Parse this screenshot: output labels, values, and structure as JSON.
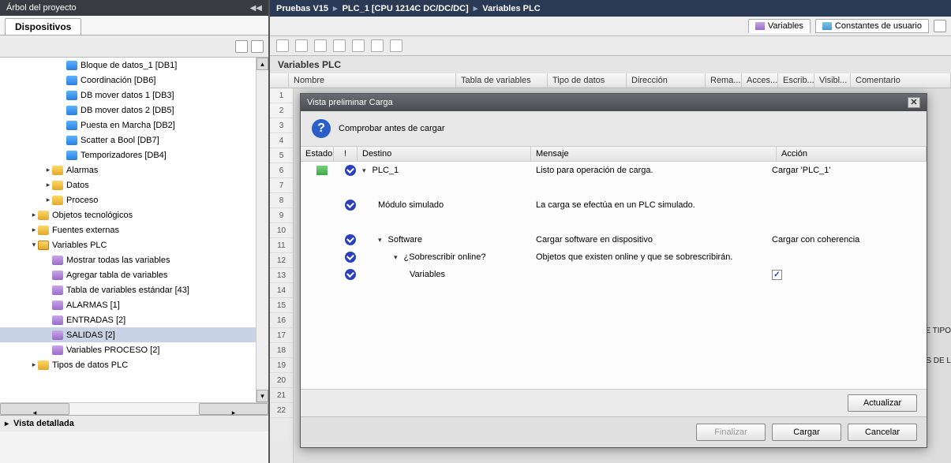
{
  "left": {
    "title": "Árbol del proyecto",
    "tab": "Dispositivos",
    "detailed_view": "Vista detallada",
    "tree": [
      {
        "indent": 3,
        "icon": "db",
        "label": "Bloque de datos_1 [DB1]"
      },
      {
        "indent": 3,
        "icon": "db",
        "label": "Coordinación [DB6]"
      },
      {
        "indent": 3,
        "icon": "db",
        "label": "DB mover datos 1 [DB3]"
      },
      {
        "indent": 3,
        "icon": "db",
        "label": "DB mover datos 2 [DB5]"
      },
      {
        "indent": 3,
        "icon": "db",
        "label": "Puesta en Marcha [DB2]"
      },
      {
        "indent": 3,
        "icon": "db",
        "label": "Scatter a Bool [DB7]"
      },
      {
        "indent": 3,
        "icon": "db",
        "label": "Temporizadores [DB4]"
      },
      {
        "indent": 2,
        "icon": "folder",
        "exp": "▸",
        "label": "Alarmas"
      },
      {
        "indent": 2,
        "icon": "folder",
        "exp": "▸",
        "label": "Datos"
      },
      {
        "indent": 2,
        "icon": "folder",
        "exp": "▸",
        "label": "Proceso"
      },
      {
        "indent": 1,
        "icon": "folder",
        "exp": "▸",
        "label": "Objetos tecnológicos"
      },
      {
        "indent": 1,
        "icon": "folder",
        "exp": "▸",
        "label": "Fuentes externas"
      },
      {
        "indent": 1,
        "icon": "varfolder",
        "exp": "▾",
        "label": "Variables PLC"
      },
      {
        "indent": 2,
        "icon": "vartable",
        "label": "Mostrar todas las variables"
      },
      {
        "indent": 2,
        "icon": "vartable",
        "label": "Agregar tabla de variables"
      },
      {
        "indent": 2,
        "icon": "vartable",
        "label": "Tabla de variables estándar [43]"
      },
      {
        "indent": 2,
        "icon": "vartable",
        "label": "ALARMAS [1]"
      },
      {
        "indent": 2,
        "icon": "vartable",
        "label": "ENTRADAS [2]"
      },
      {
        "indent": 2,
        "icon": "vartable",
        "label": "SALIDAS [2]",
        "selected": true
      },
      {
        "indent": 2,
        "icon": "vartable",
        "label": "Variables PROCESO [2]"
      },
      {
        "indent": 1,
        "icon": "folder",
        "exp": "▸",
        "label": "Tipos de datos PLC"
      }
    ]
  },
  "breadcrumb": {
    "a": "Pruebas V15",
    "b": "PLC_1 [CPU 1214C DC/DC/DC]",
    "c": "Variables PLC"
  },
  "subtabs": {
    "vars": "Variables",
    "consts": "Constantes de usuario"
  },
  "section_title": "Variables PLC",
  "columns": {
    "nombre": "Nombre",
    "tabla": "Tabla de variables",
    "tipo": "Tipo de datos",
    "dir": "Dirección",
    "rema": "Rema...",
    "acces": "Acces...",
    "escrib": "Escrib...",
    "visib": "Visibl...",
    "comentario": "Comentario"
  },
  "row_numbers": [
    "1",
    "2",
    "3",
    "4",
    "5",
    "6",
    "7",
    "8",
    "9",
    "10",
    "11",
    "12",
    "13",
    "14",
    "15",
    "16",
    "17",
    "18",
    "19",
    "20",
    "21",
    "22"
  ],
  "edge_labels": {
    "tipo": "E TIPO",
    "sdl": "S DE L"
  },
  "dialog": {
    "title": "Vista preliminar Carga",
    "subtitle": "Comprobar antes de cargar",
    "cols": {
      "estado": "Estado",
      "warn": "!",
      "destino": "Destino",
      "mensaje": "Mensaje",
      "accion": "Acción"
    },
    "rows": [
      {
        "dl": true,
        "check": true,
        "indent": 0,
        "chev": "▾",
        "dest": "PLC_1",
        "msg": "Listo para operación de carga.",
        "act": "Cargar 'PLC_1'"
      },
      {
        "blank": true
      },
      {
        "check": true,
        "indent": 1,
        "dest": "Módulo simulado",
        "msg": "La carga se efectúa en un PLC simulado.",
        "act": ""
      },
      {
        "blank": true
      },
      {
        "check": true,
        "indent": 1,
        "chev": "▾",
        "dest": "Software",
        "msg": "Cargar software en dispositivo",
        "act": "Cargar con coherencia"
      },
      {
        "check": true,
        "indent": 2,
        "chev": "▾",
        "dest": "¿Sobrescribir online?",
        "msg": "Objetos que existen online y que se sobrescribirán.",
        "act": ""
      },
      {
        "check": true,
        "indent": 3,
        "dest": "Variables",
        "msg": "",
        "checkbox": true
      }
    ],
    "buttons": {
      "actualizar": "Actualizar",
      "finalizar": "Finalizar",
      "cargar": "Cargar",
      "cancelar": "Cancelar"
    }
  }
}
